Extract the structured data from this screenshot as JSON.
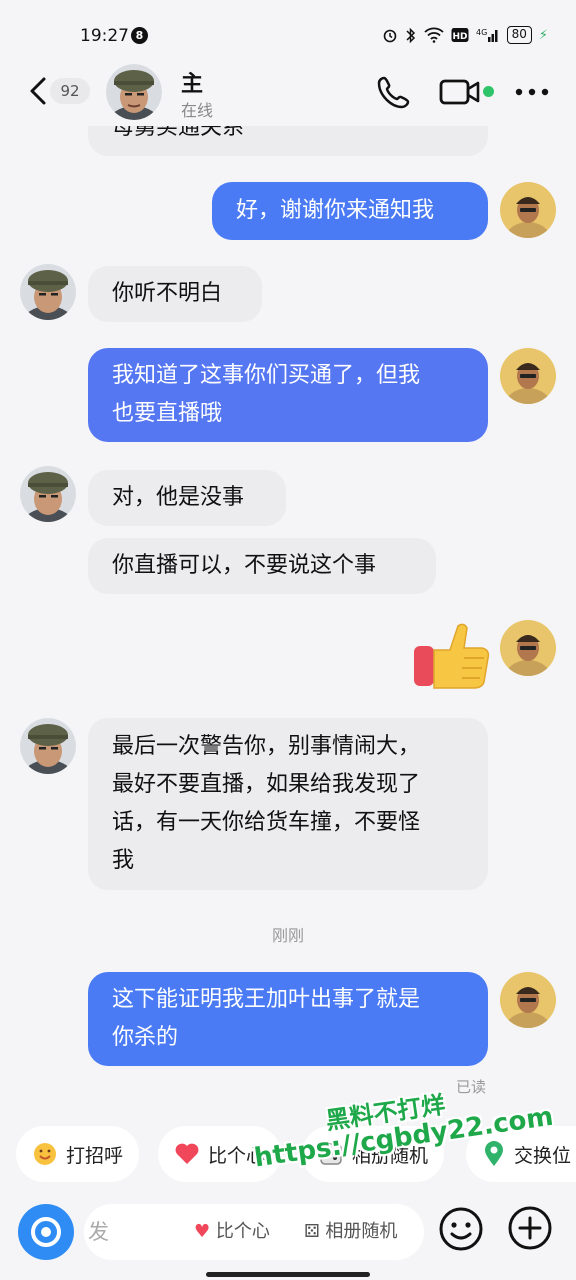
{
  "status_bar": {
    "time": "19:27",
    "notification_count": "8",
    "battery": "80"
  },
  "header": {
    "unread_count": "92",
    "contact_name": "主",
    "contact_status": "在线"
  },
  "messages": [
    {
      "side": "in",
      "text": "母舅买通关系"
    },
    {
      "side": "out",
      "text": "好，谢谢你来通知我"
    },
    {
      "side": "in",
      "text": "你听不明白"
    },
    {
      "side": "out",
      "lines": [
        "我知道了这事你们买通了，但我",
        "也要直播哦"
      ]
    },
    {
      "side": "in",
      "text": "对，他是没事"
    },
    {
      "side": "in",
      "text": "你直播可以，不要说这个事"
    },
    {
      "side": "out",
      "emoji": "👍"
    },
    {
      "side": "in",
      "lines": [
        "最后一次警告你，别事情闹大，",
        "最好不要直播，如果给我发现了",
        "话，有一天你给货车撞，不要怪",
        "我"
      ]
    },
    {
      "side": "out",
      "lines": [
        "这下能证明我王加叶出事了就是",
        "你杀的"
      ]
    }
  ],
  "timestamp": "刚刚",
  "read_receipt": "已读",
  "quick_actions": [
    {
      "label": "打招呼",
      "icon": "smile-icon"
    },
    {
      "label": "比个心",
      "icon": "heart-icon"
    },
    {
      "label": "相册随机",
      "icon": "dice-icon"
    },
    {
      "label": "交换位",
      "icon": "location-icon"
    }
  ],
  "input": {
    "placeholder": "发",
    "ghost_1": "比个心",
    "ghost_2": "相册随机"
  },
  "watermark": {
    "line1": "黑料不打烊",
    "line2": "https://cgbdy22.com"
  },
  "colors": {
    "outgoing_bubble": "#4a7bf5",
    "incoming_bubble": "#ececef",
    "online_dot": "#2fc46a",
    "camera_button": "#2f8cf5"
  }
}
